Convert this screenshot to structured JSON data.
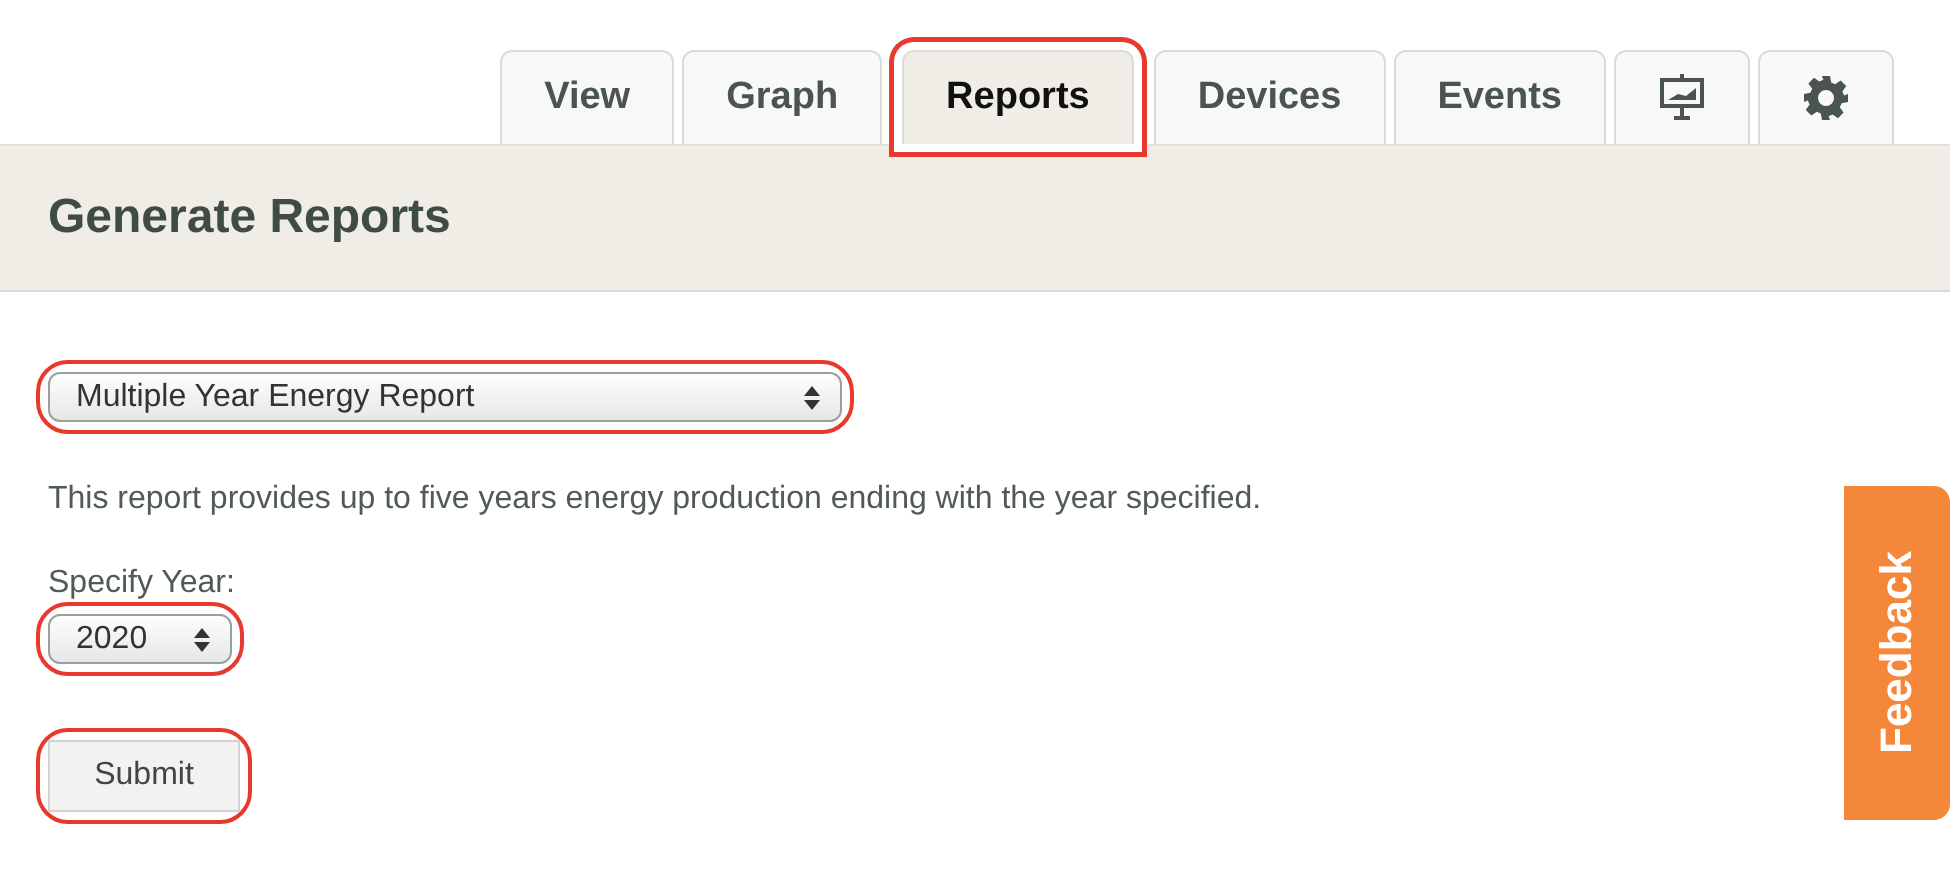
{
  "tabs": [
    {
      "kind": "text",
      "label": "View",
      "selected": false,
      "annotated": false
    },
    {
      "kind": "text",
      "label": "Graph",
      "selected": false,
      "annotated": false
    },
    {
      "kind": "text",
      "label": "Reports",
      "selected": true,
      "annotated": true
    },
    {
      "kind": "text",
      "label": "Devices",
      "selected": false,
      "annotated": false
    },
    {
      "kind": "text",
      "label": "Events",
      "selected": false,
      "annotated": false
    },
    {
      "kind": "display",
      "selected": false,
      "annotated": false
    },
    {
      "kind": "settings",
      "selected": false,
      "annotated": false
    }
  ],
  "header": {
    "title": "Generate Reports"
  },
  "report_select": {
    "value": "Multiple Year Energy Report",
    "annotated": true
  },
  "description": "This report provides up to five years energy production ending with the year specified.",
  "year": {
    "label": "Specify Year:",
    "value": "2020",
    "annotated": true
  },
  "submit": {
    "label": "Submit",
    "annotated": true
  },
  "feedback": {
    "label": "Feedback"
  }
}
